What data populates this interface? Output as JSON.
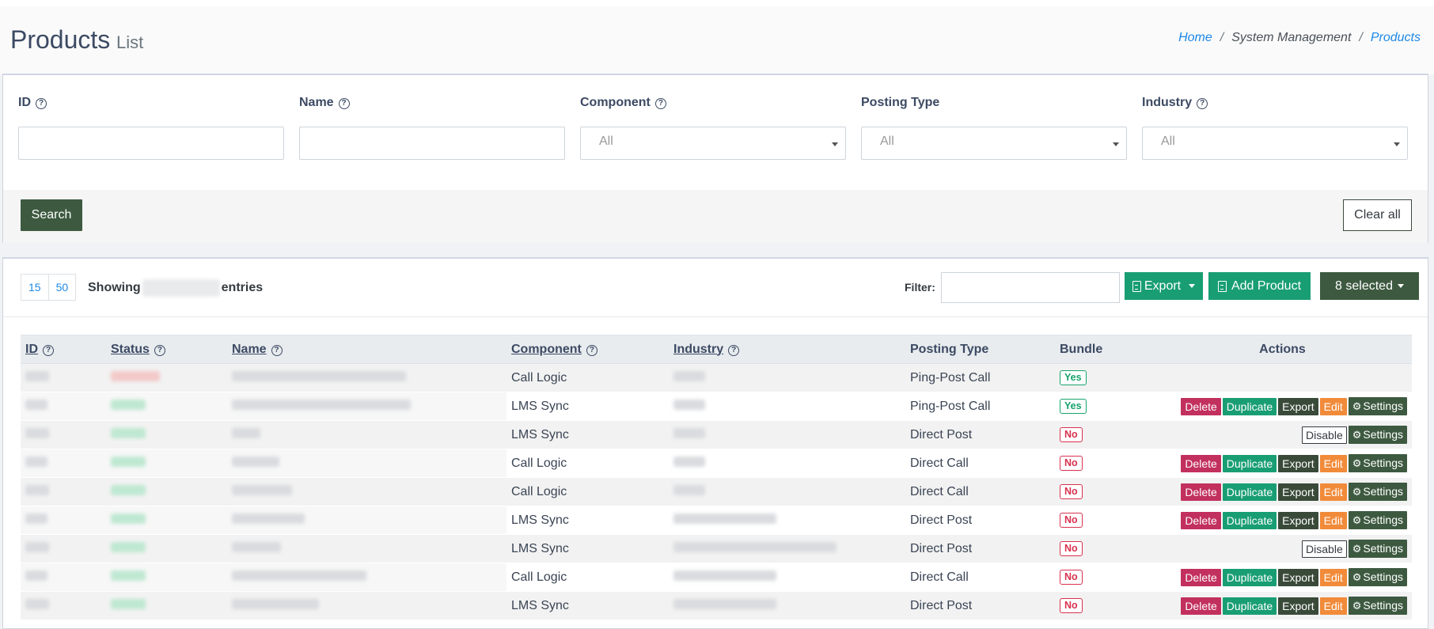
{
  "header": {
    "title": "Products",
    "subtitle": "List",
    "breadcrumb": {
      "home": "Home",
      "section": "System Management",
      "current": "Products"
    }
  },
  "filters": {
    "id_label": "ID",
    "name_label": "Name",
    "component_label": "Component",
    "posting_type_label": "Posting Type",
    "industry_label": "Industry",
    "component_value": "All",
    "posting_type_value": "All",
    "industry_value": "All",
    "search_label": "Search",
    "clear_label": "Clear all"
  },
  "toolbar": {
    "page_sizes": [
      "15",
      "50"
    ],
    "showing_prefix": "Showing",
    "showing_suffix": "entries",
    "filter_label": "Filter:",
    "export_label": "Export",
    "add_label": "Add Product",
    "selected_label": "8 selected"
  },
  "table": {
    "columns": [
      "ID",
      "Status",
      "Name",
      "Component",
      "Industry",
      "Posting Type",
      "Bundle",
      "Actions"
    ],
    "action_labels": {
      "delete": "Delete",
      "duplicate": "Duplicate",
      "export": "Export",
      "edit": "Edit",
      "settings": "Settings",
      "disable": "Disable"
    },
    "rows": [
      {
        "component": "Call Logic",
        "posting_type": "Ping-Post Call",
        "bundle": "Yes",
        "actions": "none"
      },
      {
        "component": "LMS Sync",
        "posting_type": "Ping-Post Call",
        "bundle": "Yes",
        "actions": "full"
      },
      {
        "component": "LMS Sync",
        "posting_type": "Direct Post",
        "bundle": "No",
        "actions": "disable"
      },
      {
        "component": "Call Logic",
        "posting_type": "Direct Call",
        "bundle": "No",
        "actions": "full"
      },
      {
        "component": "Call Logic",
        "posting_type": "Direct Call",
        "bundle": "No",
        "actions": "full"
      },
      {
        "component": "LMS Sync",
        "posting_type": "Direct Post",
        "bundle": "No",
        "actions": "full"
      },
      {
        "component": "LMS Sync",
        "posting_type": "Direct Post",
        "bundle": "No",
        "actions": "disable"
      },
      {
        "component": "Call Logic",
        "posting_type": "Direct Call",
        "bundle": "No",
        "actions": "full"
      },
      {
        "component": "LMS Sync",
        "posting_type": "Direct Post",
        "bundle": "No",
        "actions": "full"
      }
    ]
  }
}
